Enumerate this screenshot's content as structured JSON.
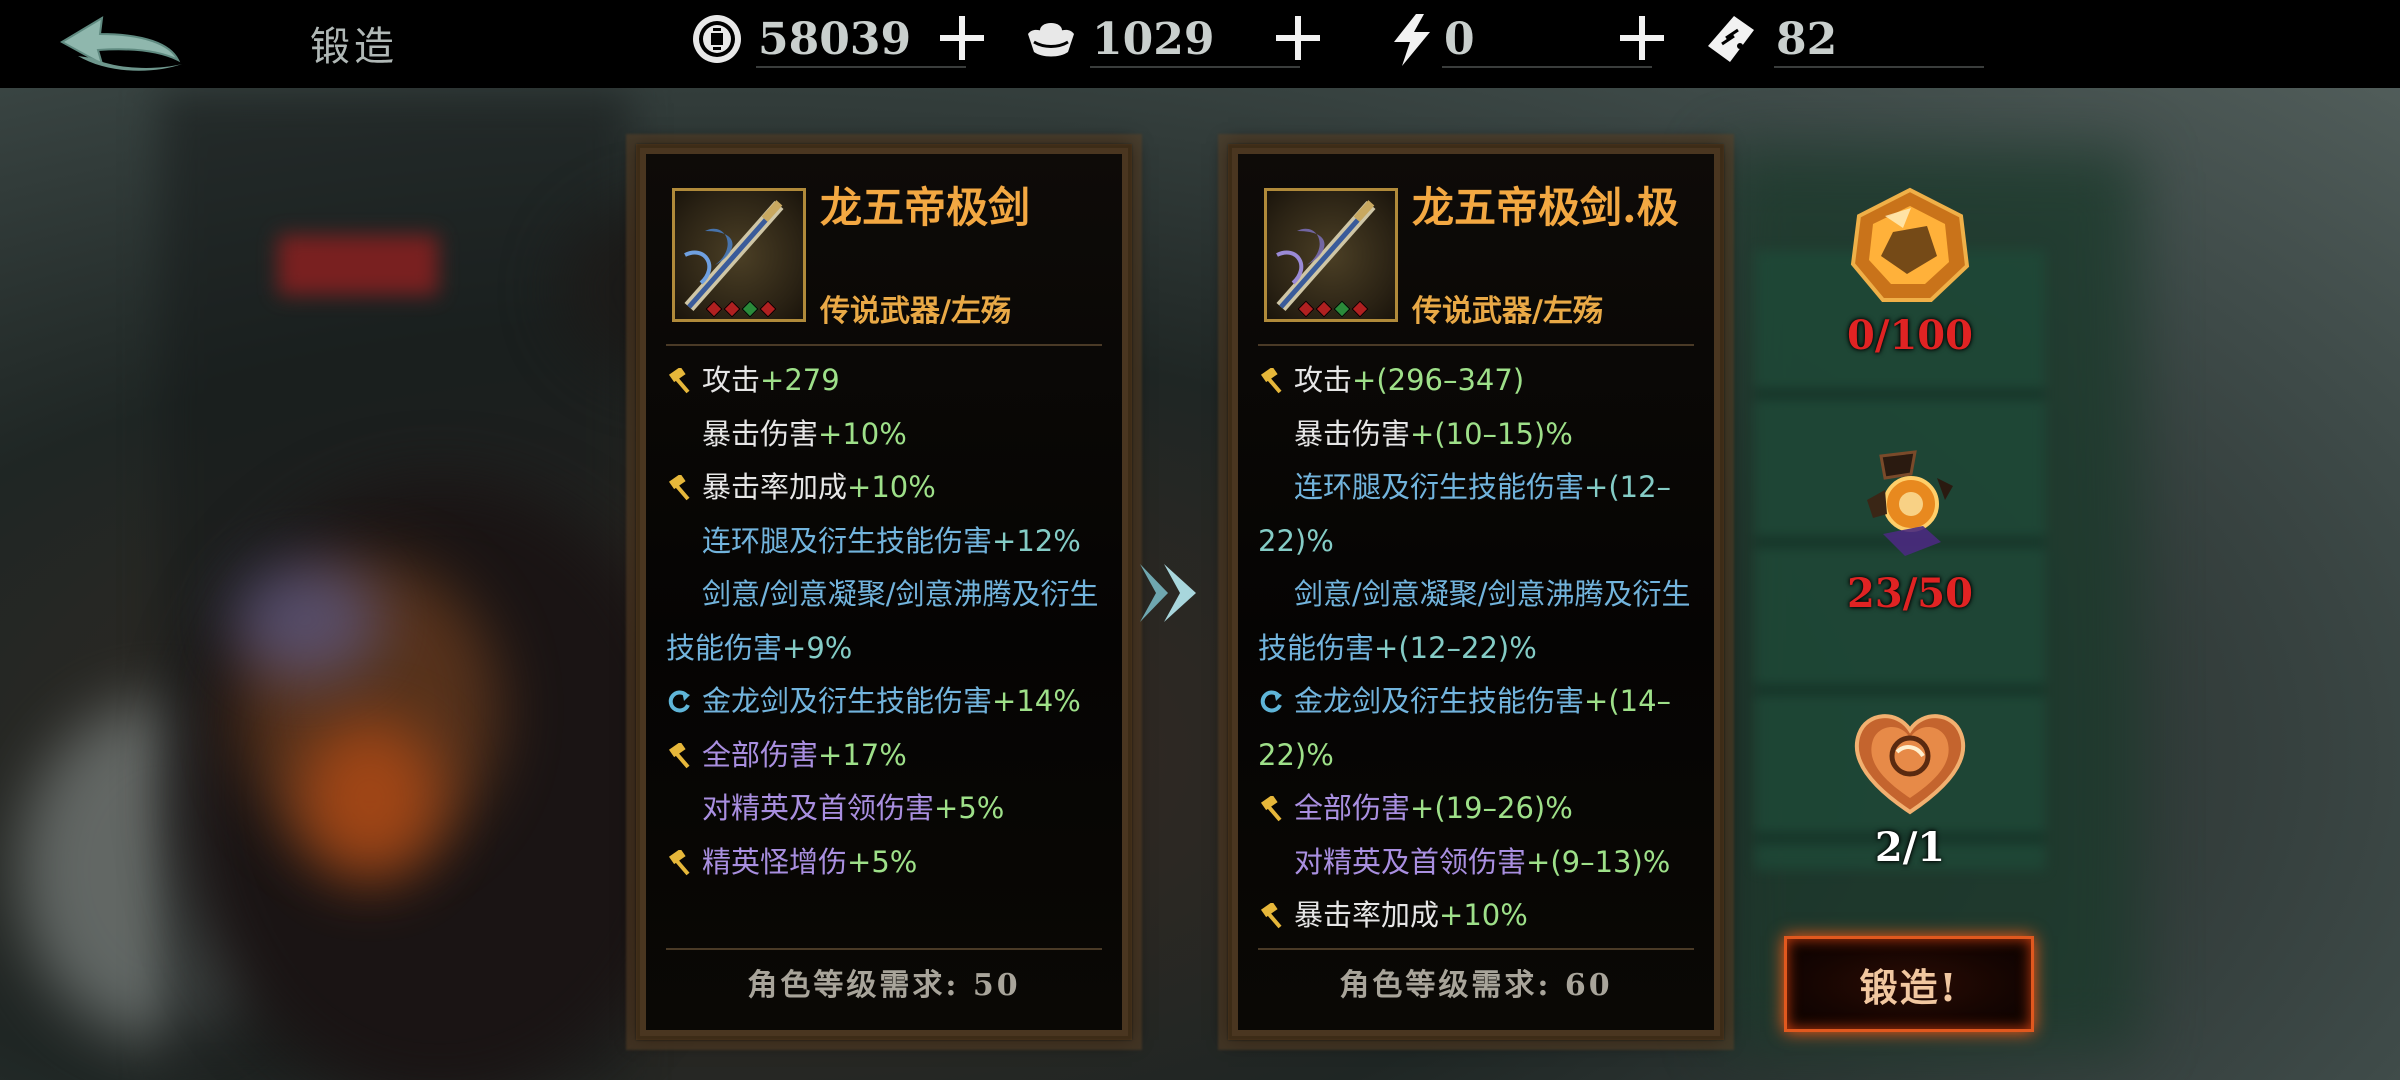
{
  "header": {
    "title": "锻造",
    "resources": [
      {
        "icon": "coin-icon",
        "value": "58039"
      },
      {
        "icon": "ingot-icon",
        "value": "1029"
      },
      {
        "icon": "lightning-icon",
        "value": "0"
      },
      {
        "icon": "ticket-icon",
        "value": "82"
      }
    ]
  },
  "current": {
    "name": "龙五帝极剑",
    "type": "传说武器/左殇",
    "stats": [
      {
        "label": "攻击",
        "value": "+279"
      },
      {
        "label": "暴击伤害",
        "value": "+10%"
      },
      {
        "label": "暴击率加成",
        "value": "+10%"
      },
      {
        "label": "连环腿及衍生技能伤害",
        "value": "+12%"
      },
      {
        "label": "剑意/剑意凝聚/剑意沸腾及衍生技能伤害",
        "value": "+9%"
      },
      {
        "label": "金龙剑及衍生技能伤害",
        "value": "+14%"
      },
      {
        "label": "全部伤害",
        "value": "+17%"
      },
      {
        "label": "对精英及首领伤害",
        "value": "+5%"
      },
      {
        "label": "精英怪增伤",
        "value": "+5%"
      }
    ],
    "requirement": "角色等级需求: 50"
  },
  "upgraded": {
    "name": "龙五帝极剑.极",
    "type": "传说武器/左殇",
    "stats": [
      {
        "label": "攻击",
        "value": "+(296–347)"
      },
      {
        "label": "暴击伤害",
        "value": "+(10–15)%"
      },
      {
        "label": "连环腿及衍生技能伤害",
        "value": "+(12–22)%"
      },
      {
        "label": "剑意/剑意凝聚/剑意沸腾及衍生技能伤害",
        "value": "+(12–22)%"
      },
      {
        "label": "金龙剑及衍生技能伤害",
        "value": "+(14–22)%"
      },
      {
        "label": "全部伤害",
        "value": "+(19–26)%"
      },
      {
        "label": "对精英及首领伤害",
        "value": "+(9–13)%"
      },
      {
        "label": "暴击率加成",
        "value": "+10%"
      }
    ],
    "requirement": "角色等级需求: 60"
  },
  "materials": [
    {
      "icon": "amber-gem-icon",
      "count": "0/100",
      "sufficient": false
    },
    {
      "icon": "broken-orb-icon",
      "count": "23/50",
      "sufficient": false
    },
    {
      "icon": "heart-emblem-icon",
      "count": "2/1",
      "sufficient": true
    }
  ],
  "forge_button": "锻造!",
  "colors": {
    "item_name": "#f3a842",
    "stat_green": "#9ee089",
    "stat_blue": "#72b4dd",
    "stat_teal": "#84ccc6",
    "stat_purple": "#a98fe0",
    "insufficient": "#e02323",
    "forge_glow": "#ff5a14"
  }
}
